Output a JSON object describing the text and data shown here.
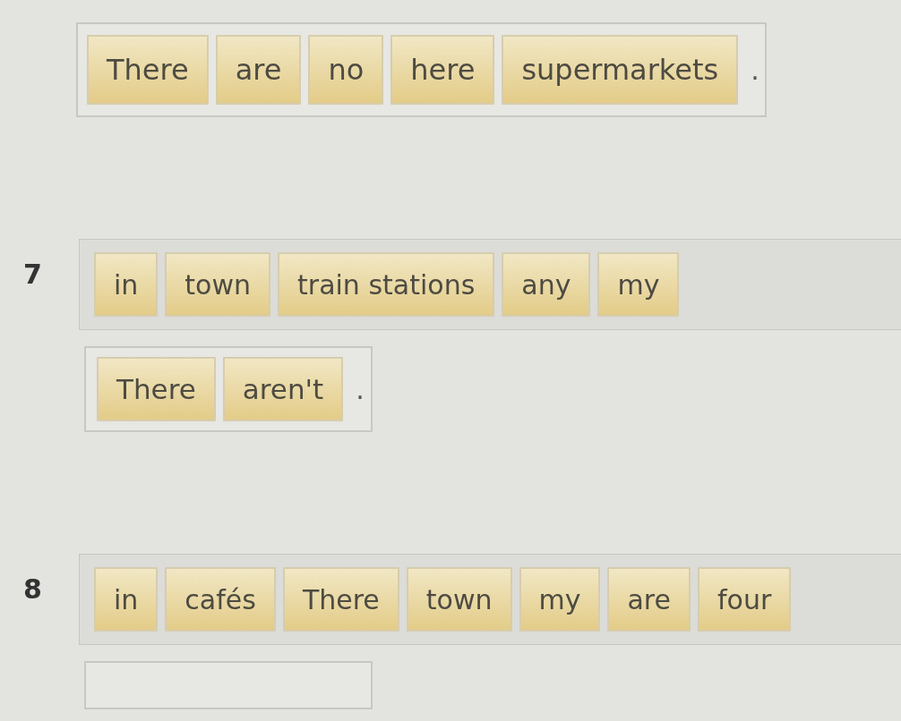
{
  "items": [
    {
      "answer": {
        "tiles": [
          "There",
          "are",
          "no",
          "here",
          "supermarkets"
        ],
        "punctuation": "."
      }
    },
    {
      "number": "7",
      "word_bank": [
        "in",
        "town",
        "train stations",
        "any",
        "my"
      ],
      "answer": {
        "tiles": [
          "There",
          "aren't"
        ],
        "punctuation": "."
      }
    },
    {
      "number": "8",
      "word_bank": [
        "in",
        "cafés",
        "There",
        "town",
        "my",
        "are",
        "four"
      ]
    }
  ]
}
